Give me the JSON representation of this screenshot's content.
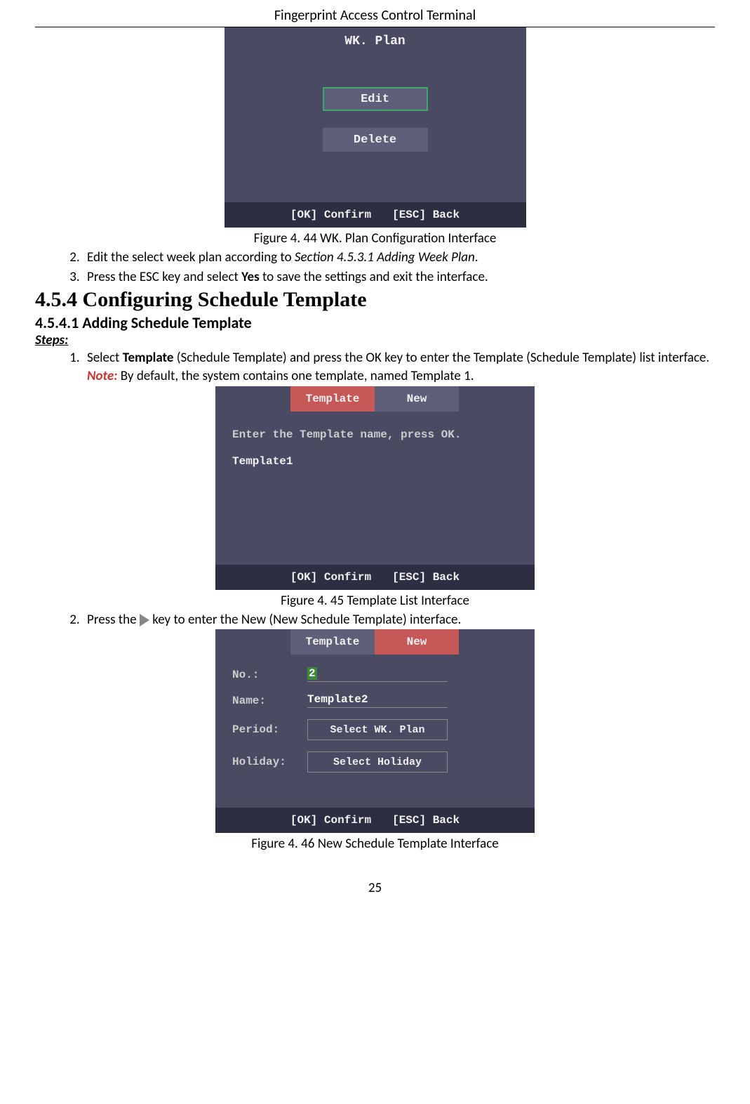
{
  "header": "Fingerprint Access Control Terminal",
  "screen1": {
    "title": "WK. Plan",
    "btn_edit": "Edit",
    "btn_delete": "Delete",
    "footer_ok": "[OK] Confirm",
    "footer_esc": "[ESC] Back"
  },
  "caption1": "Figure 4. 44 WK. Plan Configuration Interface",
  "step2_a": "Edit the select week plan according to ",
  "step2_b": "Section 4.5.3.1 Adding Week Plan",
  "step2_c": ".",
  "step3_a": "Press the ESC key and select ",
  "step3_b": "Yes",
  "step3_c": " to save the settings and exit the interface.",
  "section_454": "4.5.4   Configuring Schedule Template",
  "section_4541": "4.5.4.1 Adding Schedule Template",
  "steps_label": "Steps:",
  "step1_a": "Select ",
  "step1_b": "Template",
  "step1_c": " (Schedule Template) and press the OK key to enter the Template (Schedule Template) list interface.",
  "note_label": "Note:",
  "note_text": " By default, the system contains one template, named Template 1.",
  "screen2": {
    "tab_template": "Template",
    "tab_new": "New",
    "prompt": "Enter the Template name, press OK.",
    "entry": "Template1",
    "footer_ok": "[OK] Confirm",
    "footer_esc": "[ESC] Back"
  },
  "caption2": "Figure 4. 45 Template List Interface",
  "step2b_a": "Press the ",
  "step2b_b": " key to enter the New (New Schedule Template) interface.",
  "screen3": {
    "tab_template": "Template",
    "tab_new": "New",
    "label_no": "No.:",
    "val_no": "2",
    "label_name": "Name:",
    "val_name": "Template2",
    "label_period": "Period:",
    "val_period": "Select WK. Plan",
    "label_holiday": "Holiday:",
    "val_holiday": "Select Holiday",
    "footer_ok": "[OK] Confirm",
    "footer_esc": "[ESC] Back"
  },
  "caption3": "Figure 4. 46 New Schedule Template Interface",
  "page_number": "25"
}
